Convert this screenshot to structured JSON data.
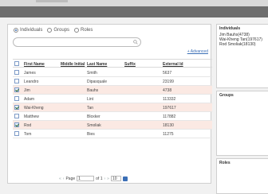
{
  "filter": {
    "options": [
      {
        "label": "Individuals",
        "checked": true
      },
      {
        "label": "Groups",
        "checked": false
      },
      {
        "label": "Roles",
        "checked": false
      }
    ],
    "search_value": "",
    "advanced_label": "+ Advanced"
  },
  "grid": {
    "headers": [
      "First Name",
      "Middle Initial",
      "Last Name",
      "Suffix",
      "External Id"
    ],
    "rows": [
      {
        "checked": false,
        "first": "James",
        "middle": "",
        "last": "Smith",
        "suffix": "",
        "external": "5637"
      },
      {
        "checked": false,
        "first": "Leandro",
        "middle": "",
        "last": "Dipasquale",
        "suffix": "",
        "external": "23199"
      },
      {
        "checked": true,
        "first": "Jim",
        "middle": "",
        "last": "Bauhs",
        "suffix": "",
        "external": "4738"
      },
      {
        "checked": false,
        "first": "Adam",
        "middle": "",
        "last": "Lint",
        "suffix": "",
        "external": "113332"
      },
      {
        "checked": true,
        "first": "Wai-Kheng",
        "middle": "",
        "last": "Tan",
        "suffix": "",
        "external": "197617"
      },
      {
        "checked": false,
        "first": "Matthew",
        "middle": "",
        "last": "Bloxker",
        "suffix": "",
        "external": "117882"
      },
      {
        "checked": true,
        "first": "Rod",
        "middle": "",
        "last": "Smoliak",
        "suffix": "",
        "external": "18130"
      },
      {
        "checked": false,
        "first": "Tom",
        "middle": "",
        "last": "Bies",
        "suffix": "",
        "external": "11275"
      }
    ]
  },
  "pager": {
    "first": "«",
    "prev": "‹",
    "page_label": "Page",
    "page_value": "1",
    "of_label": "of 1",
    "next": "›",
    "last": "»",
    "page_size": "10"
  },
  "panels": {
    "individuals_title": "Individuals",
    "individuals_list": [
      "Jim Bauhs(4738)",
      "Wai-Kheng Tan(197617)",
      "Rod Smoliak(18130)"
    ],
    "groups_title": "Groups",
    "roles_title": "Roles"
  },
  "colors": {
    "selected_row": "#fbe9e3",
    "link": "#3b6fb6",
    "modal_header": "#6e6e6e"
  }
}
